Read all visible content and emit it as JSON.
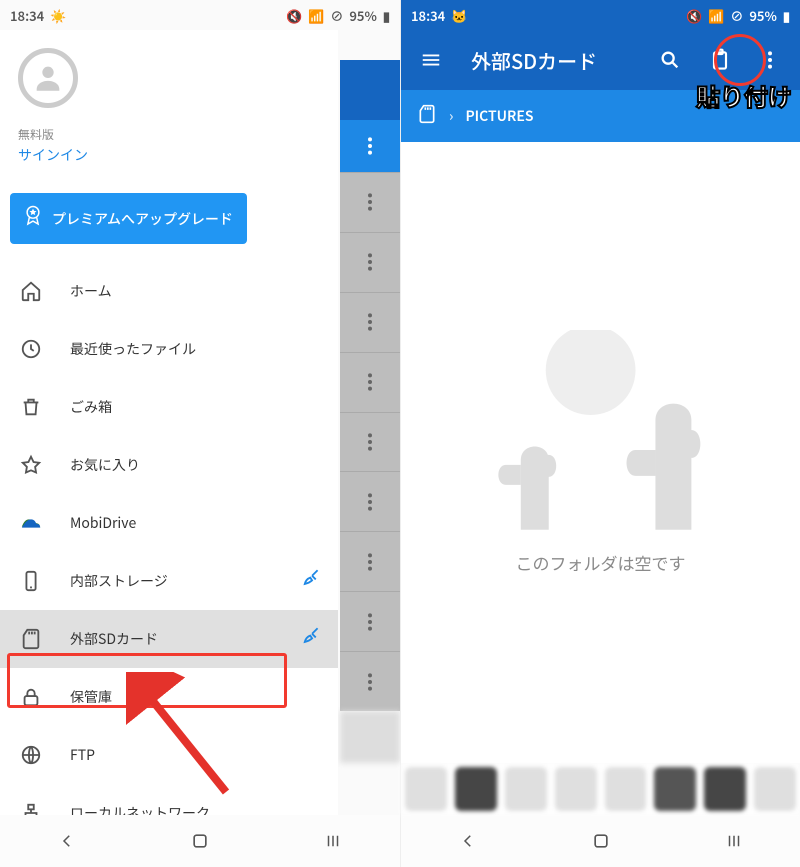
{
  "status": {
    "time": "18:34",
    "battery": "95%"
  },
  "left": {
    "plan_label": "無料版",
    "signin_label": "サインイン",
    "upgrade_label": "プレミアムへアップグレード",
    "nav_items": [
      "ホーム",
      "最近使ったファイル",
      "ごみ箱",
      "お気に入り"
    ],
    "storage_items": [
      "MobiDrive",
      "内部ストレージ",
      "外部SDカード",
      "保管庫",
      "FTP",
      "ローカルネットワーク"
    ],
    "selected_storage_index": 2
  },
  "right": {
    "title": "外部SDカード",
    "breadcrumb_root_icon": "sd-card-icon",
    "breadcrumb_path": "PICTURES",
    "empty_text": "このフォルダは空です",
    "annotation_paste_label": "貼り付け"
  }
}
